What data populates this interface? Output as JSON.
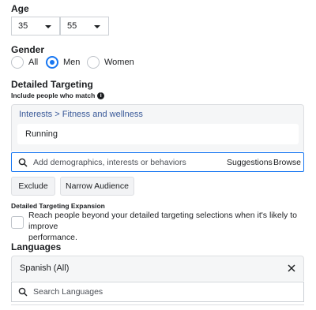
{
  "age": {
    "label": "Age",
    "min_value": "35",
    "max_value": "55"
  },
  "gender": {
    "label": "Gender",
    "options": [
      "All",
      "Men",
      "Women"
    ],
    "selected": "Men"
  },
  "detailed_targeting": {
    "label": "Detailed Targeting",
    "include_label": "Include people who match",
    "breadcrumb": "Interests > Fitness and wellness",
    "selected_item": "Running",
    "search_placeholder": "Add demographics, interests or behaviors",
    "suggestions_label": "Suggestions",
    "browse_label": "Browse",
    "exclude_label": "Exclude",
    "narrow_label": "Narrow Audience"
  },
  "expansion": {
    "label": "Detailed Targeting Expansion",
    "description_line1": "Reach people beyond your detailed targeting selections when it's likely to improve",
    "description_line2": "performance."
  },
  "languages": {
    "label": "Languages",
    "selected_language": "Spanish (All)",
    "search_placeholder": "Search Languages"
  },
  "colors": {
    "accent": "#1877f2",
    "link": "#385898",
    "border": "#ccd0d5",
    "panel_bg": "#f5f6f7"
  }
}
